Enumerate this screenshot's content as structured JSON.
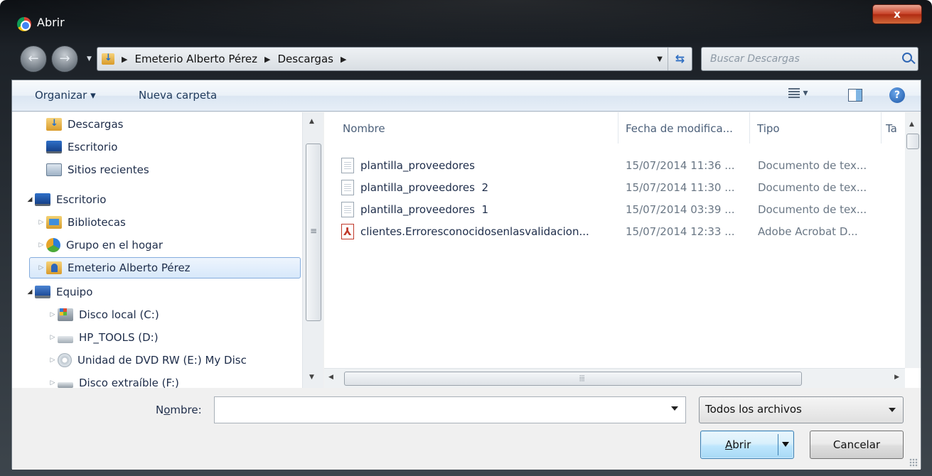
{
  "window": {
    "title": "Abrir",
    "close_label": "x"
  },
  "address": {
    "crumbs": [
      "Emeterio Alberto Pérez",
      "Descargas"
    ],
    "search_placeholder": "Buscar Descargas"
  },
  "toolbar": {
    "organize_label": "Organizar ▾",
    "new_folder_label": "Nueva carpeta",
    "views_label": "▾",
    "help_label": "?"
  },
  "nav": {
    "items": [
      {
        "label": "Descargas",
        "icon": "downloads-folder-icon",
        "expander": ""
      },
      {
        "label": "Escritorio",
        "icon": "desktop-icon",
        "expander": ""
      },
      {
        "label": "Sitios recientes",
        "icon": "recent-places-icon",
        "expander": ""
      },
      {
        "label": "Escritorio",
        "icon": "desktop-icon",
        "expander": "◢"
      },
      {
        "label": "Bibliotecas",
        "icon": "libraries-icon",
        "expander": "▷"
      },
      {
        "label": "Grupo en el hogar",
        "icon": "homegroup-icon",
        "expander": "▷"
      },
      {
        "label": "Emeterio Alberto Pérez",
        "icon": "user-folder-icon",
        "expander": "▷"
      },
      {
        "label": "Equipo",
        "icon": "computer-icon",
        "expander": "◢"
      },
      {
        "label": "Disco local (C:)",
        "icon": "local-disk-icon",
        "expander": "▷"
      },
      {
        "label": "HP_TOOLS (D:)",
        "icon": "drive-icon",
        "expander": "▷"
      },
      {
        "label": "Unidad de DVD RW (E:) My Disc",
        "icon": "dvd-icon",
        "expander": "▷"
      },
      {
        "label": "Disco extraíble (F:)",
        "icon": "removable-disk-icon",
        "expander": "▷"
      }
    ],
    "selected": "Emeterio Alberto Pérez"
  },
  "files": {
    "columns": [
      "Nombre",
      "Fecha de modifica...",
      "Tipo",
      "Ta"
    ],
    "rows": [
      {
        "name": "plantilla_proveedores",
        "date": "15/07/2014 11:36 ...",
        "type": "Documento de tex...",
        "icon": "text-file-icon"
      },
      {
        "name": "plantilla_proveedores  2",
        "date": "15/07/2014 11:30 ...",
        "type": "Documento de tex...",
        "icon": "text-file-icon"
      },
      {
        "name": "plantilla_proveedores  1",
        "date": "15/07/2014 03:39 ...",
        "type": "Documento de tex...",
        "icon": "text-file-icon"
      },
      {
        "name": "clientes.Erroresconocidosenlasvalidacion...",
        "date": "15/07/2014 12:33 ...",
        "type": "Adobe Acrobat D...",
        "icon": "pdf-file-icon"
      }
    ]
  },
  "bottom": {
    "filename_label_pre": "N",
    "filename_label_ul": "o",
    "filename_label_post": "mbre:",
    "filename_value": "",
    "filter_value": "Todos los archivos",
    "open_label_ul": "A",
    "open_label_post": "brir",
    "cancel_label": "Cancelar"
  }
}
